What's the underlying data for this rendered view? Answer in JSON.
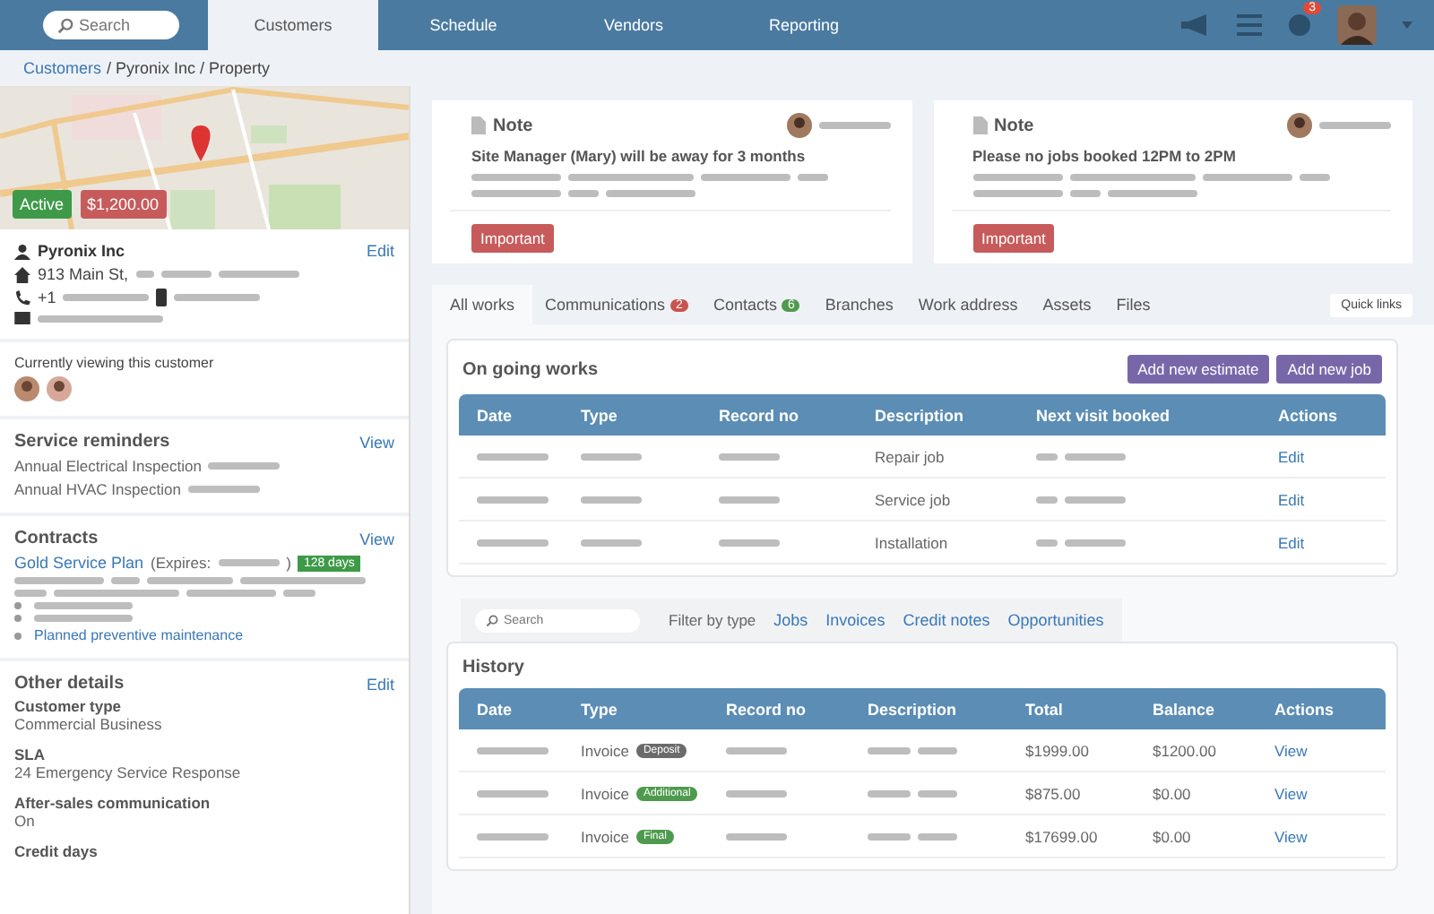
{
  "nav": {
    "search_placeholder": "Search",
    "tabs": [
      {
        "label": "Customers",
        "selected": true
      },
      {
        "label": "Schedule",
        "selected": false
      },
      {
        "label": "Vendors",
        "selected": false
      },
      {
        "label": "Reporting",
        "selected": false
      }
    ],
    "notification_count": "3"
  },
  "breadcrumb": {
    "link": "Customers",
    "rest": "/ Pyronix Inc / Property"
  },
  "customer": {
    "status": "Active",
    "balance": "$1,200.00",
    "name": "Pyronix Inc",
    "edit": "Edit",
    "address": "913 Main St,",
    "phone": "+1"
  },
  "viewing": {
    "title": "Currently viewing this customer"
  },
  "service_reminders": {
    "title": "Service reminders",
    "action": "View",
    "items": [
      "Annual Electrical Inspection",
      "Annual HVAC Inspection"
    ]
  },
  "contracts": {
    "title": "Contracts",
    "action": "View",
    "plan": "Gold Service Plan",
    "expires": "(Expires:",
    "close": ")",
    "days": "128 days",
    "bullet_link": "Planned preventive maintenance"
  },
  "other_details": {
    "title": "Other details",
    "action": "Edit",
    "fields": [
      {
        "label": "Customer type",
        "value": "Commercial Business"
      },
      {
        "label": "SLA",
        "value": "24 Emergency Service Response"
      },
      {
        "label": "After-sales communication",
        "value": "On"
      },
      {
        "label": "Credit days"
      }
    ]
  },
  "notes": [
    {
      "title": "Note",
      "text": "Site Manager (Mary) will be away for 3 months",
      "tag": "Important"
    },
    {
      "title": "Note",
      "text": "Please no jobs booked 12PM to 2PM",
      "tag": "Important"
    }
  ],
  "tabs": [
    {
      "label": "All works",
      "selected": true
    },
    {
      "label": "Communications",
      "selected": false,
      "count": "2",
      "color": "#c9534f"
    },
    {
      "label": "Contacts",
      "selected": false,
      "count": "6",
      "color": "#4e9a4e"
    },
    {
      "label": "Branches",
      "selected": false
    },
    {
      "label": "Work address",
      "selected": false
    },
    {
      "label": "Assets",
      "selected": false
    },
    {
      "label": "Files",
      "selected": false
    }
  ],
  "quick_links": "Quick links",
  "ongoing": {
    "title": "On going works",
    "buttons": [
      "Add new estimate",
      "Add new job"
    ],
    "columns": [
      "Date",
      "Type",
      "Record no",
      "Description",
      "Next visit booked",
      "Actions"
    ],
    "rows": [
      {
        "description": "Repair job",
        "action": "Edit"
      },
      {
        "description": "Service job",
        "action": "Edit"
      },
      {
        "description": "Installation",
        "action": "Edit"
      }
    ]
  },
  "history": {
    "search_placeholder": "Search",
    "filter_label": "Filter by type",
    "filters": [
      "Jobs",
      "Invoices",
      "Credit notes",
      "Opportunities"
    ],
    "title": "History",
    "columns": [
      "Date",
      "Type",
      "Record no",
      "Description",
      "Total",
      "Balance",
      "Actions"
    ],
    "rows": [
      {
        "type": "Invoice",
        "tag": "Deposit",
        "color": "#6b6b6b",
        "total": "$1999.00",
        "balance": "$1200.00",
        "action": "View"
      },
      {
        "type": "Invoice",
        "tag": "Additional",
        "color": "#4e9a4e",
        "total": "$875.00",
        "balance": "$0.00",
        "action": "View"
      },
      {
        "type": "Invoice",
        "tag": "Final",
        "color": "#4e9a4e",
        "total": "$17699.00",
        "balance": "$0.00",
        "action": "View"
      }
    ]
  }
}
